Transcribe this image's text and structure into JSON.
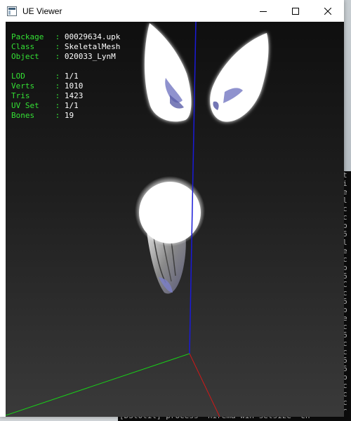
{
  "window": {
    "title": "UE Viewer",
    "buttons": {
      "minimize_icon": "minimize-icon",
      "maximize_icon": "maximize-icon",
      "close_icon": "close-icon"
    }
  },
  "info_block": {
    "object_info": [
      {
        "key": "Package",
        "sep": " : ",
        "value": "00029634.upk"
      },
      {
        "key": "Class",
        "sep": " : ",
        "value": "SkeletalMesh"
      },
      {
        "key": "Object",
        "sep": " : ",
        "value": "020033_LynM"
      }
    ],
    "mesh_info": [
      {
        "key": "LOD",
        "sep": " : ",
        "value": "1/1"
      },
      {
        "key": "Verts",
        "sep": " : ",
        "value": "1010"
      },
      {
        "key": "Tris",
        "sep": " : ",
        "value": "1423"
      },
      {
        "key": "UV Set",
        "sep": " : ",
        "value": "1/1"
      },
      {
        "key": "Bones",
        "sep": " : ",
        "value": "19"
      }
    ],
    "colors": {
      "label": "#34e034",
      "value": "#ffffff"
    }
  },
  "axes_colors": {
    "x": "#d01818",
    "y": "#18d018",
    "z": "#1a1ad8"
  },
  "background_console": {
    "bottom_line": "[DSt0til] process  nirema win setsize  ch",
    "side_glyphs": [
      "t",
      "i",
      "e",
      "l",
      "c",
      "c",
      "b",
      "6",
      "l",
      "e",
      "c",
      "b",
      "6",
      "C",
      "c",
      "6",
      "b",
      "e",
      "c",
      "6",
      "c",
      "c",
      "6",
      "6",
      "b",
      "c",
      "c",
      "c",
      "c"
    ]
  }
}
